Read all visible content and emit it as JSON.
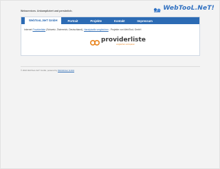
{
  "header": {
    "tagline": "Webservices. Unkompliziert und persönlich.",
    "logo_text": "WebTooL.NeT!"
  },
  "nav": {
    "items": [
      {
        "label": "WebTooL.NeT GmbH"
      },
      {
        "label": "Portrait"
      },
      {
        "label": "Projekte"
      },
      {
        "label": "Kontakt"
      },
      {
        "label": "Impressum"
      }
    ]
  },
  "content": {
    "desc_prefix": "Internet",
    "desc_link1": "Providerliste",
    "desc_middle": "(Schweiz, Österreich, Deutschland),",
    "desc_link2": "Handytarife vergleichen",
    "desc_suffix": "- Projekte von WebTooL GmbH",
    "provider_logo_text": "providerliste",
    "provider_logo_sub": "vergleichen und sparen"
  },
  "footer": {
    "text": "© 2022 WebTooL.NeT! GmbH, powered by",
    "link": "WebAdvisor GmbH"
  },
  "colors": {
    "accent": "#2c6bb4",
    "brand_orange": "#e8821a"
  }
}
